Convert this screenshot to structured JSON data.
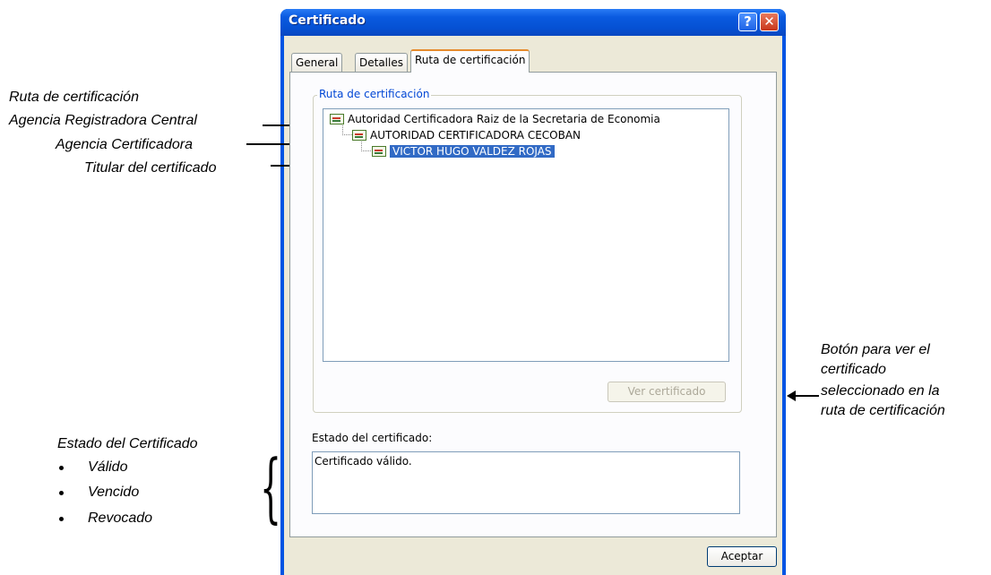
{
  "window": {
    "title": "Certificado",
    "help_glyph": "?",
    "close_glyph": "✕"
  },
  "tabs": [
    {
      "label": "General"
    },
    {
      "label": "Detalles"
    },
    {
      "label": "Ruta de certificación",
      "active": true
    }
  ],
  "path_group": {
    "legend": "Ruta de certificación",
    "items": [
      {
        "label": "Autoridad Certificadora Raiz de la Secretaria de Economia",
        "icon": "certificate-icon"
      },
      {
        "label": "AUTORIDAD CERTIFICADORA CECOBAN",
        "icon": "certificate-icon"
      },
      {
        "label": "VICTOR HUGO VALDEZ ROJAS",
        "icon": "certificate-icon",
        "selected": true
      }
    ],
    "view_button": "Ver certificado"
  },
  "status": {
    "label": "Estado del certificado:",
    "value": "Certificado válido."
  },
  "ok_button": "Aceptar",
  "annotations": {
    "path_title": "Ruta de certificación",
    "root_ca": "Agencia Registradora Central",
    "intermediate_ca": "Agencia Certificadora",
    "holder": "Titular del certificado",
    "view_button_note": [
      "Botón para ver el",
      "certificado",
      "seleccionado en la",
      "ruta de certificación"
    ],
    "status_title": "Estado del Certificado",
    "status_values": [
      "Válido",
      "Vencido",
      "Revocado"
    ]
  },
  "colors": {
    "titlebar": "#0054e3",
    "selection": "#316ac5",
    "group_legend": "#0046d5",
    "active_tab_accent": "#e68b2c"
  }
}
